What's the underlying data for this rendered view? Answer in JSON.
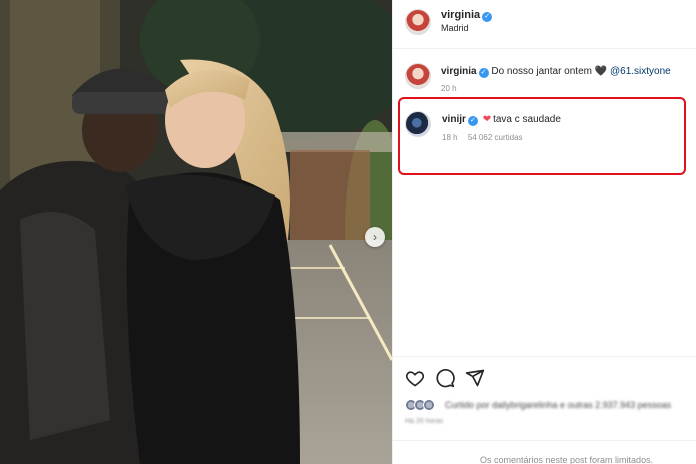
{
  "post": {
    "username": "virginia",
    "location": "Madrid",
    "verified_mark": "✓",
    "carousel_next_icon": "chevron-right-icon"
  },
  "caption": {
    "username": "virginia",
    "text": "Do nosso jantar ontem",
    "emoji": "🖤",
    "mention": "@61.sixtyone",
    "time": "20 h"
  },
  "comment": {
    "username": "vinijr",
    "emoji": "❤",
    "text": "tava c saudade",
    "time": "18 h",
    "likes": "54 062 curtidas"
  },
  "actions": {
    "like_icon": "heart-icon",
    "comment_icon": "comment-icon",
    "share_icon": "share-icon"
  },
  "likes": {
    "text": "Curtido por dailybrigarelinha e outras 2.937.943 pessoas"
  },
  "date": "Há 20 horas",
  "footer": {
    "limited_text": "Os comentários neste post foram limitados."
  },
  "colors": {
    "highlight_border": "#e0101c",
    "verified": "#3897f0",
    "heart": "#ed4956",
    "mention": "#00376b"
  }
}
